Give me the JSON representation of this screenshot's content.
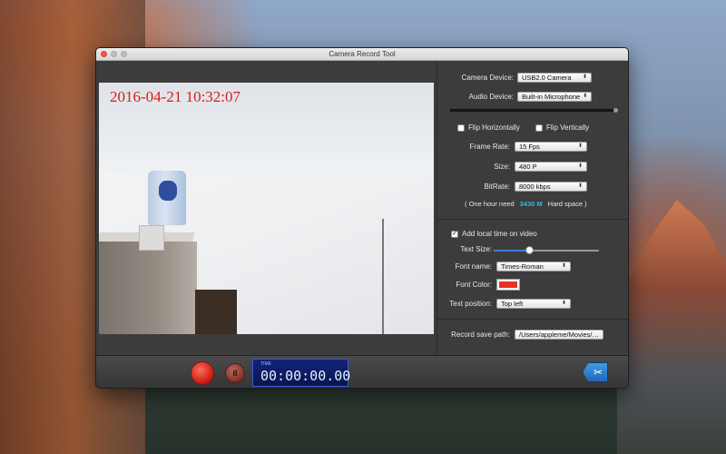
{
  "window": {
    "title": "Camera Record Tool"
  },
  "video": {
    "timestamp": "2016-04-21 10:32:07"
  },
  "settings": {
    "camera_device": {
      "label": "Camera Device:",
      "value": "USB2.0 Camera"
    },
    "audio_device": {
      "label": "Audio Device:",
      "value": "Built-in Microphone"
    },
    "flip_horizontal": {
      "label": "Flip Horizontally",
      "checked": false
    },
    "flip_vertical": {
      "label": "Flip Vertically",
      "checked": false
    },
    "frame_rate": {
      "label": "Frame Rate:",
      "value": "15 Fps"
    },
    "size": {
      "label": "Size:",
      "value": "480 P"
    },
    "bitrate": {
      "label": "BitRate:",
      "value": "8000 kbps"
    },
    "space_note": {
      "prefix": "( One hour need",
      "value": "3430 M",
      "suffix": "Hard space )"
    }
  },
  "overlay": {
    "add_time": {
      "label": "Add local time on video",
      "checked": true
    },
    "text_size": {
      "label": "Text Size:",
      "level": 0.33
    },
    "font_name": {
      "label": "Font name:",
      "value": "Times-Roman"
    },
    "font_color": {
      "label": "Font Color:",
      "color": "#e63224"
    },
    "text_position": {
      "label": "Text position:",
      "value": "Top left"
    }
  },
  "save_path": {
    "label": "Record save path:",
    "value": "/Users/appleme/Movies/…"
  },
  "controls": {
    "timer_caption": "TIME",
    "timer_value": "00:00:00.00"
  },
  "icons": {
    "record": "record-icon",
    "pause": "pause-icon",
    "scissors": "scissors-icon"
  },
  "colors": {
    "accent": "#3fb2e8",
    "record_red": "#d61c1c"
  }
}
